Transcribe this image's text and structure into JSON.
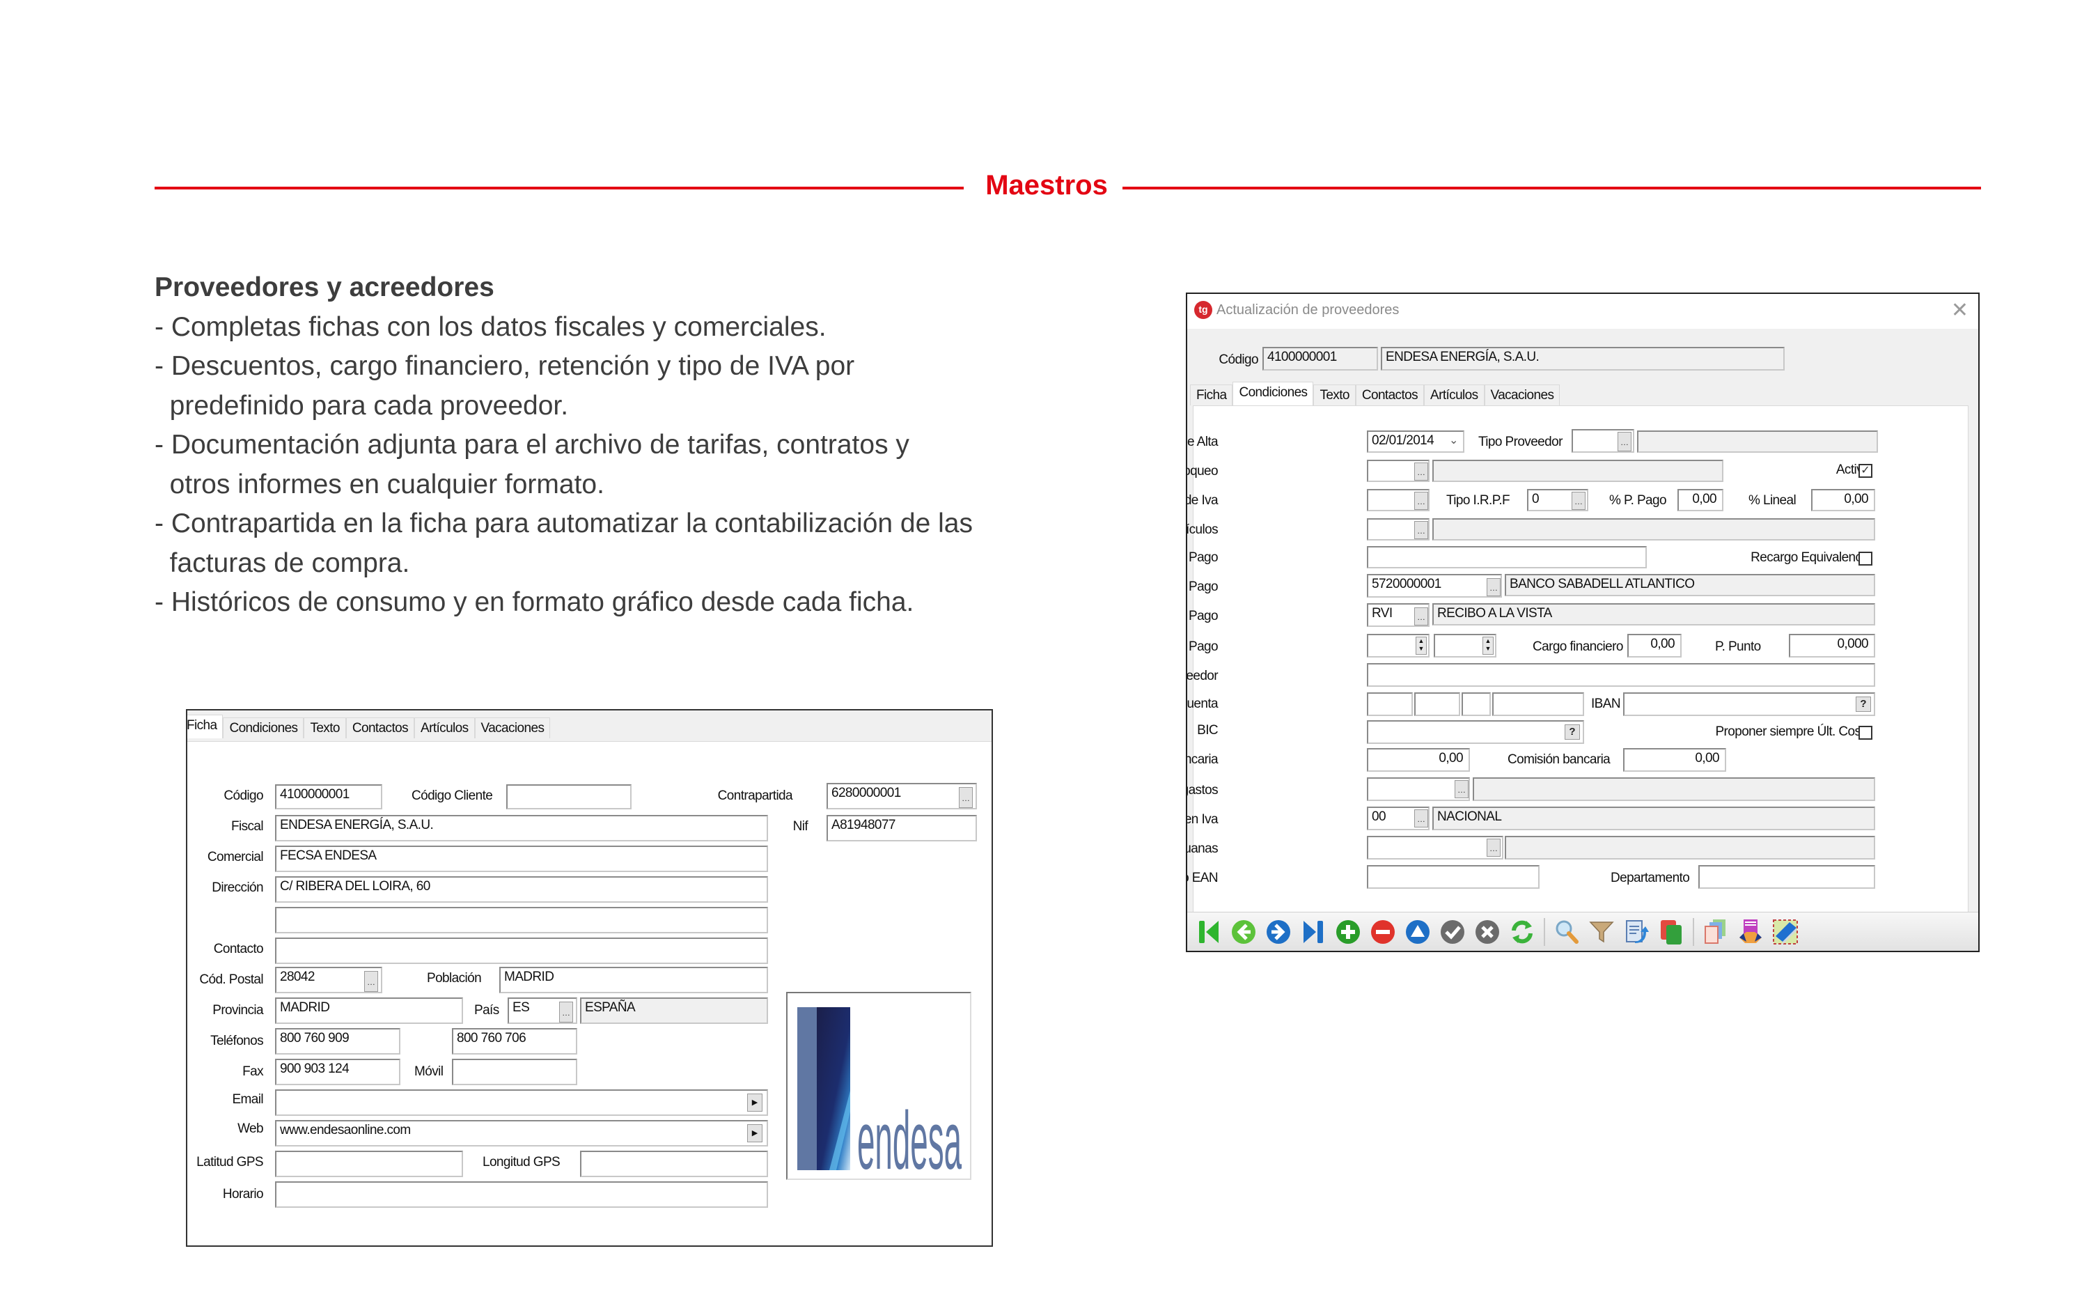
{
  "header": {
    "title": "Maestros",
    "accent": "#e30613"
  },
  "intro": {
    "heading": "Proveedores y acreedores",
    "lines": [
      "- Completas fichas con los datos fiscales y comerciales.",
      "- Descuentos, cargo financiero, retención y tipo de IVA por",
      "  predefinido para cada proveedor.",
      "- Documentación adjunta para el archivo de tarifas, contratos y",
      "  otros informes en cualquier formato.",
      "- Contrapartida en la ficha para automatizar la contabilización de las",
      "  facturas de compra.",
      "- Históricos de consumo y en formato gráfico desde cada ficha."
    ]
  },
  "ficha": {
    "tabs": [
      "Ficha",
      "Condiciones",
      "Texto",
      "Contactos",
      "Artículos",
      "Vacaciones"
    ],
    "active_tab": "Ficha",
    "labels": {
      "codigo": "Código",
      "codigo_cliente": "Código Cliente",
      "contrapartida": "Contrapartida",
      "fiscal": "Fiscal",
      "nif": "Nif",
      "comercial": "Comercial",
      "direccion": "Dirección",
      "contacto": "Contacto",
      "cod_postal": "Cód. Postal",
      "poblacion": "Población",
      "provincia": "Provincia",
      "pais": "País",
      "telefonos": "Teléfonos",
      "fax": "Fax",
      "movil": "Móvil",
      "email": "Email",
      "web": "Web",
      "latitud": "Latitud GPS",
      "longitud": "Longitud GPS",
      "horario": "Horario"
    },
    "values": {
      "codigo": "4100000001",
      "codigo_cliente": "",
      "contrapartida": "6280000001",
      "fiscal": "ENDESA ENERGÍA, S.A.U.",
      "nif": "A81948077",
      "comercial": "FECSA ENDESA",
      "direccion": "C/ RIBERA DEL LOIRA, 60",
      "direccion2": "",
      "contacto": "",
      "cod_postal": "28042",
      "poblacion": "MADRID",
      "provincia": "MADRID",
      "pais_code": "ES",
      "pais_name": "ESPAÑA",
      "telefono1": "800 760 909",
      "telefono2": "800 760 706",
      "fax": "900 903 124",
      "movil": "",
      "email": "",
      "web": "www.endesaonline.com",
      "latitud": "",
      "longitud": "",
      "horario": ""
    },
    "logo_text": "endesa"
  },
  "window": {
    "title": "Actualización de proveedores",
    "codigo_label": "Código",
    "codigo_value": "4100000001",
    "nombre_value": "ENDESA ENERGÍA, S.A.U.",
    "tabs": [
      "Ficha",
      "Condiciones",
      "Texto",
      "Contactos",
      "Artículos",
      "Vacaciones"
    ],
    "active_tab": "Condiciones",
    "labels": {
      "fecha_alta": "Fecha de Alta",
      "tipo_proveedor": "Tipo Proveedor",
      "tipo_bloqueo": "Tipo de bloqueo",
      "activo": "Activo",
      "tipo_iva": "Tipo de Iva",
      "tipo_irpf": "Tipo I.R.P.F",
      "p_pago": "% P. Pago",
      "lineal": "% Lineal",
      "idioma": "Idioma Artículos",
      "forma_pago": "Forma de Pago",
      "recargo": "Recargo Equivalencia",
      "banco_pago": "Banco de Pago",
      "forma_pago2": "Forma de Pago",
      "dias_pago": "Días de Pago",
      "cargo_fin": "Cargo financiero",
      "p_punto": "P. Punto",
      "banco_prov": "Banco proveedor",
      "n_cuenta": "Nº de cuenta",
      "iban": "IBAN",
      "bic": "BIC",
      "proponer": "Proponer siempre Últ. Coste",
      "comision_pct": "% Comisión bancaria",
      "comision": "Comisión bancaria",
      "cuenta_gastos": "Cuenta de gastos",
      "regimen_iva": "Régimen Iva",
      "cta_aduanas": "Cta. de Aduanas",
      "codigo_ean": "Código EAN",
      "departamento": "Departamento"
    },
    "values": {
      "fecha_alta": "02/01/2014",
      "tipo_proveedor": "",
      "tipo_bloqueo": "",
      "activo": true,
      "tipo_iva": "",
      "tipo_irpf": "0",
      "p_pago": "0,00",
      "lineal": "0,00",
      "idioma": "",
      "forma_pago": "",
      "recargo": false,
      "banco_pago_code": "5720000001",
      "banco_pago_name": "BANCO SABADELL ATLANTICO",
      "forma_pago_code": "RVI",
      "forma_pago_name": "RECIBO A LA VISTA",
      "dias_pago_1": "",
      "dias_pago_2": "",
      "cargo_fin": "0,00",
      "p_punto": "0,000",
      "banco_prov": "",
      "iban": "",
      "bic": "",
      "proponer": false,
      "comision_pct": "0,00",
      "comision": "0,00",
      "cuenta_gastos": "",
      "regimen_iva_code": "00",
      "regimen_iva_name": "NACIONAL",
      "cta_aduanas": "",
      "codigo_ean": "",
      "departamento": ""
    },
    "toolbar": [
      "first-record-icon",
      "previous-record-icon",
      "next-record-icon",
      "last-record-icon",
      "add-record-icon",
      "delete-record-icon",
      "edit-record-icon",
      "accept-icon",
      "cancel-icon",
      "refresh-icon",
      "search-icon",
      "filter-icon",
      "export-icon",
      "copy-record-icon",
      "documents-icon",
      "agreement-icon",
      "book-icon"
    ]
  }
}
